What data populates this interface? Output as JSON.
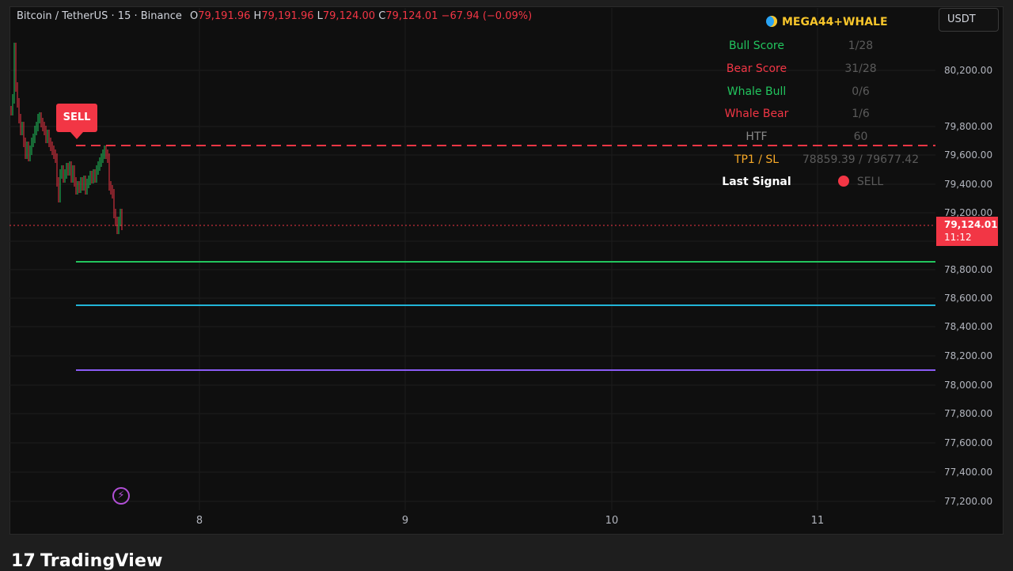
{
  "header": {
    "symbol": "Bitcoin / TetherUS · 15 · Binance",
    "o_label": "O",
    "o_value": "79,191.96",
    "h_label": "H",
    "h_value": "79,191.96",
    "l_label": "L",
    "l_value": "79,124.00",
    "c_label": "C",
    "c_value": "79,124.01",
    "change": "−67.94 (−0.09%)"
  },
  "currency_button": "USDT",
  "price_axis": [
    "80,200.00",
    "79,800.00",
    "79,600.00",
    "79,400.00",
    "79,200.00",
    "78,800.00",
    "78,600.00",
    "78,400.00",
    "78,200.00",
    "78,000.00",
    "77,800.00",
    "77,600.00",
    "77,400.00",
    "77,200.00"
  ],
  "time_axis": [
    "8",
    "9",
    "10",
    "11"
  ],
  "last_price": {
    "price": "79,124.01",
    "countdown": "11:12"
  },
  "signal_label": "SELL",
  "panel": {
    "title": "MEGA44+WHALE",
    "rows": [
      {
        "label": "Bull Score",
        "value": "1/28",
        "color": "#22c55e"
      },
      {
        "label": "Bear Score",
        "value": "31/28",
        "color": "#f23645"
      },
      {
        "label": "Whale Bull",
        "value": "0/6",
        "color": "#22c55e"
      },
      {
        "label": "Whale Bear",
        "value": "1/6",
        "color": "#f23645"
      },
      {
        "label": "HTF",
        "value": "60",
        "color": "#8a8a8a"
      },
      {
        "label": "TP1 / SL",
        "value": "78859.39 / 79677.42",
        "color": "#f7a928"
      },
      {
        "label": "Last Signal",
        "value": "SELL",
        "color": "#ffffff"
      }
    ]
  },
  "brand": "TradingView",
  "colors": {
    "bull": "#22c55e",
    "bear": "#f23645",
    "sl_line": "#f23645",
    "tp1_line": "#22c55e",
    "tp2_line": "#22b5d8",
    "tp3_line": "#8b5cf6"
  }
}
